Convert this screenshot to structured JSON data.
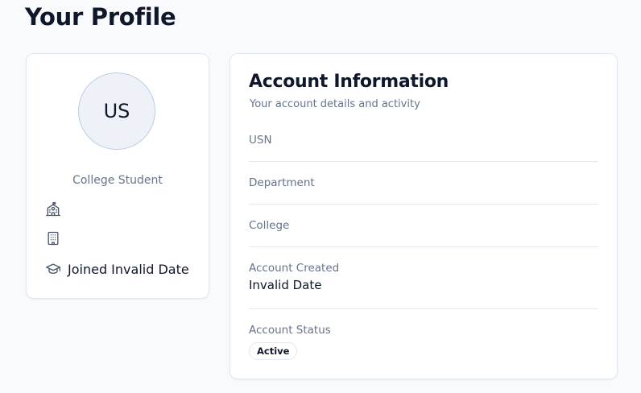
{
  "page": {
    "title": "Your Profile"
  },
  "profile": {
    "initials": "US",
    "role": "College Student",
    "rows": [
      {
        "icon": "school-icon",
        "text": ""
      },
      {
        "icon": "building-icon",
        "text": ""
      },
      {
        "icon": "graduation-cap-icon",
        "text": "Joined Invalid Date"
      }
    ]
  },
  "account": {
    "title": "Account Information",
    "subtitle": "Your account details and activity",
    "fields": {
      "usn": {
        "label": "USN",
        "value": ""
      },
      "department": {
        "label": "Department",
        "value": ""
      },
      "college": {
        "label": "College",
        "value": ""
      },
      "created": {
        "label": "Account Created",
        "value": "Invalid Date"
      },
      "status": {
        "label": "Account Status",
        "value": "Active"
      }
    }
  },
  "colors": {
    "background": "#f8fafc",
    "card": "#ffffff",
    "border": "#e2e8f0",
    "muted_text": "#64748b",
    "text": "#0f172a",
    "avatar_bg": "#eef2f8"
  }
}
